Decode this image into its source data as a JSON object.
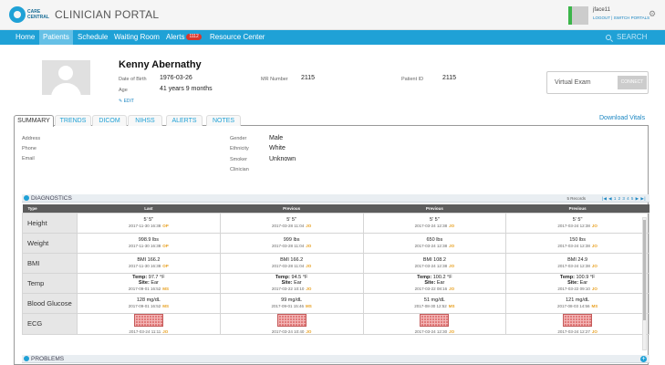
{
  "brand": {
    "logo_text": "CARE CENTRAL",
    "portal_title": "CLINICIAN PORTAL"
  },
  "user": {
    "name": "jface11",
    "logout": "LOGOUT",
    "switch": "SWITCH PORTALS"
  },
  "nav": {
    "items": [
      "Home",
      "Patients",
      "Schedule",
      "Waiting Room",
      "Alerts",
      "Resource Center"
    ],
    "alerts_badge": "1112",
    "search_label": "SEARCH"
  },
  "patient": {
    "name": "Kenny Abernathy",
    "dob_label": "Date of Birth",
    "dob": "1976-03-26",
    "age_label": "Age",
    "age": "41 years 9 months",
    "mr_label": "MR Number",
    "mr": "2115",
    "pid_label": "Patient ID",
    "pid": "2115",
    "edit": "EDIT"
  },
  "virtual_exam": {
    "label": "Virtual Exam",
    "button": "CONNECT"
  },
  "tabs": [
    "SUMMARY",
    "TRENDS",
    "DICOM",
    "NIHSS",
    "ALERTS",
    "NOTES"
  ],
  "download_vitals": "Download Vitals",
  "summary": {
    "address_label": "Address",
    "phone_label": "Phone",
    "email_label": "Email",
    "gender_label": "Gender",
    "gender": "Male",
    "ethnicity_label": "Ethnicity",
    "ethnicity": "White",
    "smoker_label": "Smoker",
    "smoker": "Unknown",
    "clinician_label": "Clinician"
  },
  "diagnostics": {
    "title": "DIAGNOSTICS",
    "records": "5 Records",
    "pager": "|◀ ◀ 1 2 3 4 5 ▶ ▶|",
    "headers": [
      "Type",
      "Last",
      "Previous",
      "Previous",
      "Previous"
    ],
    "rows": [
      {
        "label": "Height",
        "cells": [
          {
            "v": "5' 5\"",
            "d": "2017-11-30 16:38",
            "s": "OP"
          },
          {
            "v": "5' 5\"",
            "d": "2017-03-28 11:04",
            "s": "JO"
          },
          {
            "v": "5' 5\"",
            "d": "2017-03-24 12:38",
            "s": "JO"
          },
          {
            "v": "5' 5\"",
            "d": "2017-03-24 12:38",
            "s": "JO"
          }
        ]
      },
      {
        "label": "Weight",
        "cells": [
          {
            "v": "998.9 lbs",
            "d": "2017-11-30 16:38",
            "s": "OP"
          },
          {
            "v": "999 lbs",
            "d": "2017-03-28 11:04",
            "s": "JO"
          },
          {
            "v": "650 lbs",
            "d": "2017-03-24 12:38",
            "s": "JO"
          },
          {
            "v": "150 lbs",
            "d": "2017-03-24 12:38",
            "s": "JO"
          }
        ]
      },
      {
        "label": "BMI",
        "cells": [
          {
            "v": "BMI 166.2",
            "d": "2017-11-30 16:38",
            "s": "OP"
          },
          {
            "v": "BMI 166.2",
            "d": "2017-03-28 11:04",
            "s": "JO"
          },
          {
            "v": "BMI 108.2",
            "d": "2017-03-24 12:38",
            "s": "JO"
          },
          {
            "v": "BMI 24.9",
            "d": "2017-03-24 12:38",
            "s": "JO"
          }
        ]
      },
      {
        "label": "Temp",
        "cells": [
          {
            "t": "Temp:",
            "tv": "97.7 °F",
            "site": "Site:",
            "sv": "Ear",
            "d": "2017-09-01 16:52",
            "s": "MS"
          },
          {
            "t": "Temp:",
            "tv": "94.5 °F",
            "site": "Site:",
            "sv": "Ear",
            "d": "2017-03-22 10:10",
            "s": "JO"
          },
          {
            "t": "Temp:",
            "tv": "100.2 °F",
            "site": "Site:",
            "sv": "Ear",
            "d": "2017-03-22 08:16",
            "s": "JO"
          },
          {
            "t": "Temp:",
            "tv": "100.9 °F",
            "site": "Site:",
            "sv": "Ear",
            "d": "2017-03-22 09:10",
            "s": "JO"
          }
        ]
      },
      {
        "label": "Blood Glucose",
        "cells": [
          {
            "v": "128 mg/dL",
            "d": "2017-09-01 16:52",
            "s": "MS"
          },
          {
            "v": "99 mg/dL",
            "d": "2017-09-01 15:46",
            "s": "MS"
          },
          {
            "v": "51 mg/dL",
            "d": "2017-08-30 12:52",
            "s": "MS"
          },
          {
            "v": "121 mg/dL",
            "d": "2017-08-03 14:56",
            "s": "MS"
          }
        ]
      },
      {
        "label": "ECG",
        "cells": [
          {
            "ecg": true,
            "d": "2017-03-24 11:11",
            "s": "JO"
          },
          {
            "ecg": true,
            "d": "2017-03-24 10:40",
            "s": "JO"
          },
          {
            "ecg": true,
            "d": "2017-03-24 12:30",
            "s": "JO"
          },
          {
            "ecg": true,
            "d": "2017-03-24 12:27",
            "s": "JO"
          }
        ]
      }
    ]
  },
  "problems": {
    "title": "PROBLEMS"
  },
  "colors": {
    "accent": "#1fa1d6",
    "badge": "#d9372c",
    "source": "#e8a020"
  }
}
